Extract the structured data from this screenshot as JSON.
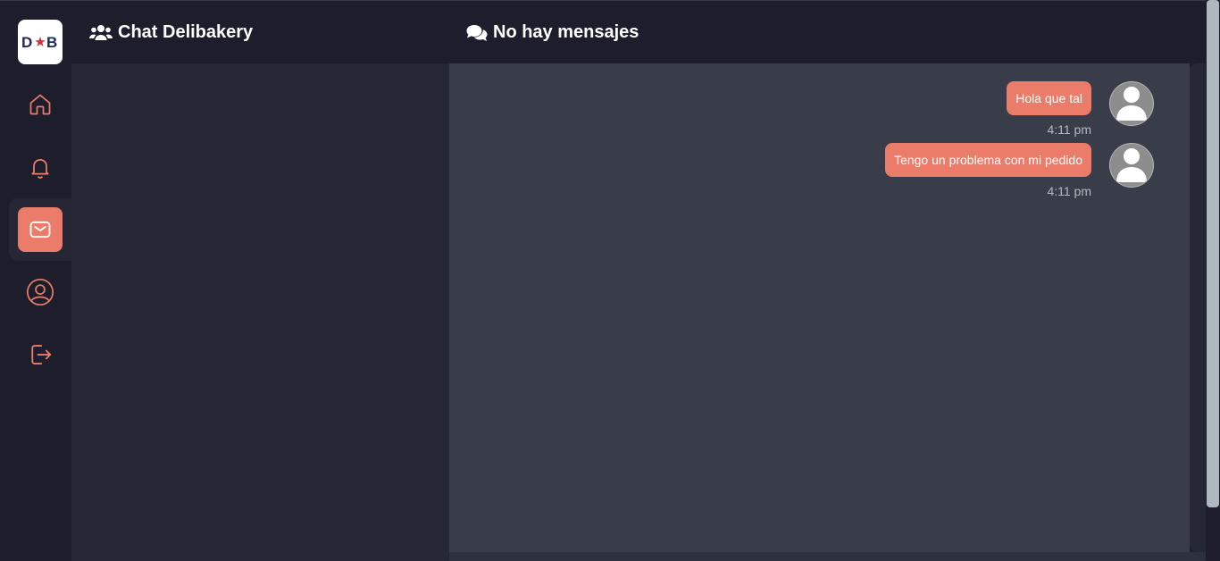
{
  "logo": {
    "text_left": "D",
    "text_right": "B",
    "icon": "star-icon"
  },
  "sidebar": {
    "items": [
      {
        "name": "home",
        "icon": "home-icon"
      },
      {
        "name": "notifications",
        "icon": "bell-icon"
      },
      {
        "name": "messages",
        "icon": "mail-icon",
        "active": true
      },
      {
        "name": "profile",
        "icon": "user-circle-icon"
      },
      {
        "name": "logout",
        "icon": "logout-icon"
      }
    ]
  },
  "header": {
    "left_title": "Chat Delibakery",
    "left_icon": "users-icon",
    "right_title": "No hay mensajes",
    "right_icon": "comments-icon"
  },
  "messages": [
    {
      "text": "Hola que tal",
      "time": "4:11 pm"
    },
    {
      "text": "Tengo un problema con mi pedido",
      "time": "4:11 pm"
    }
  ],
  "colors": {
    "accent": "#ea7c69",
    "sidebar_bg": "#1e1d2b",
    "list_bg": "#262835",
    "chat_bg": "#393c49"
  }
}
